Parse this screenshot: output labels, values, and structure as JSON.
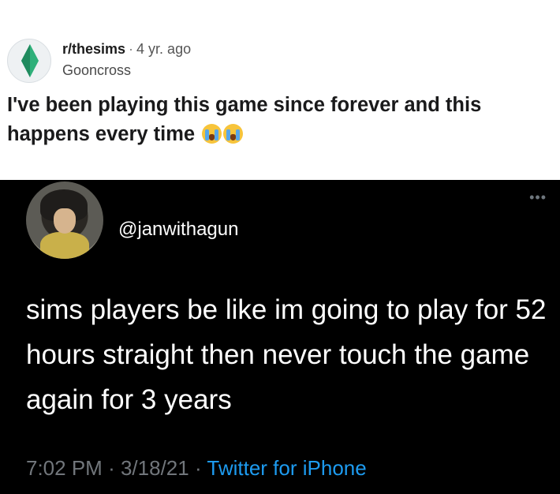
{
  "post": {
    "subreddit": "r/thesims",
    "separator": "·",
    "age": "4 yr. ago",
    "author": "Gooncross",
    "title": "I've been playing this game since forever and this happens every time"
  },
  "tweet": {
    "handle": "@janwithagun",
    "more": "•••",
    "text": "sims players be like im going to play for 52 hours straight then never touch the game again for 3 years",
    "time": "7:02 PM",
    "date": "3/18/21",
    "source": "Twitter for iPhone",
    "separator": "·"
  },
  "colors": {
    "plumbob": "#2fb07a",
    "link": "#1d9bf0",
    "tweet_bg": "#000000"
  },
  "icons": {
    "subreddit": "plumbob-icon",
    "title_emoji": "loudly-crying-face-icon"
  }
}
